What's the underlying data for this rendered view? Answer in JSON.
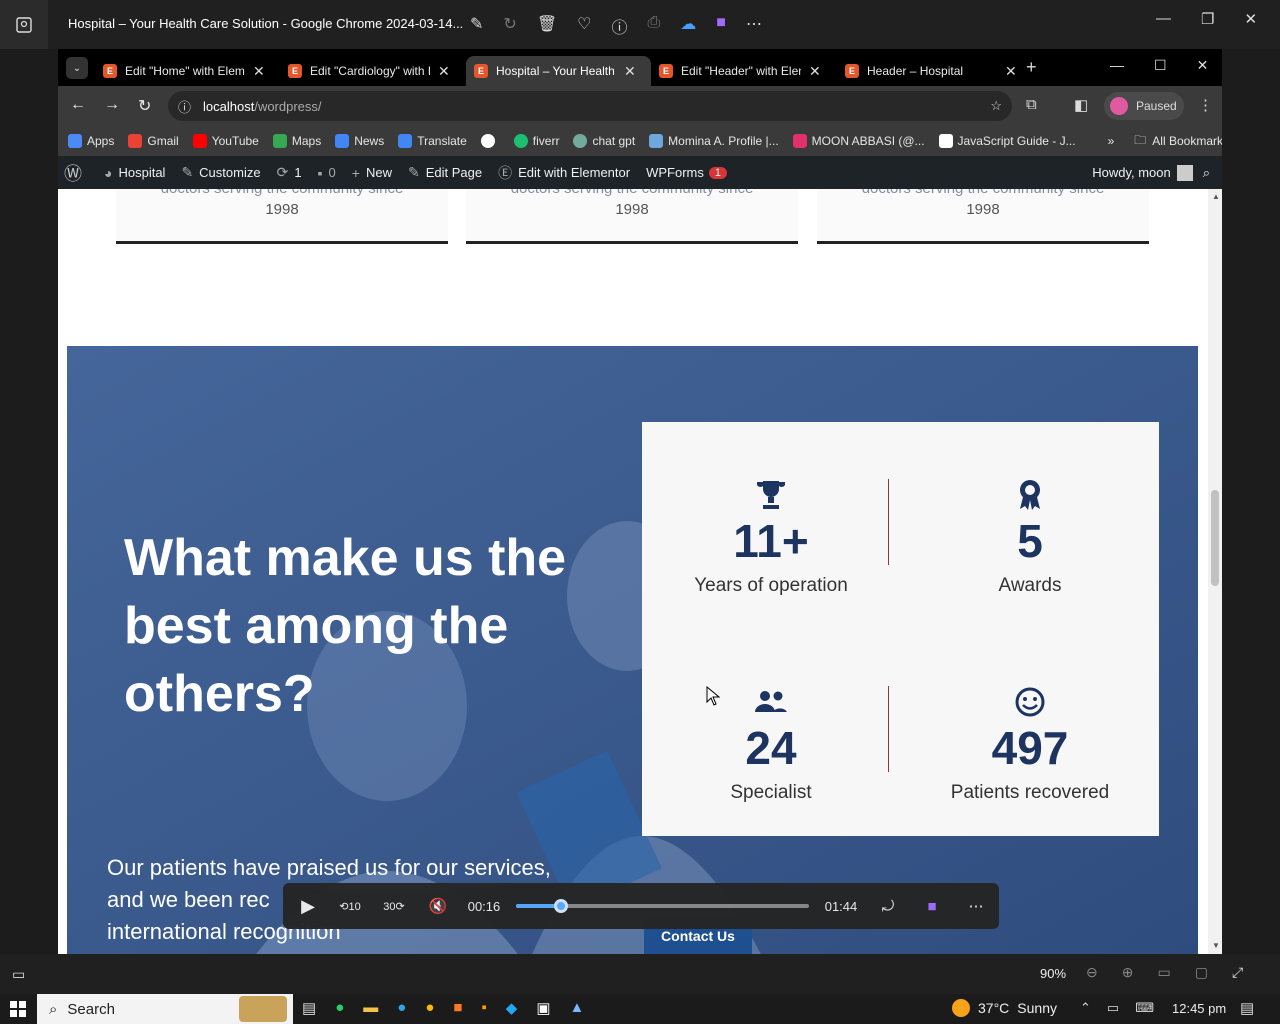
{
  "window": {
    "title": "Hospital – Your Health Care Solution - Google Chrome 2024-03-14..."
  },
  "chrome": {
    "tabs": [
      {
        "label": "Edit \"Home\" with Elementor"
      },
      {
        "label": "Edit \"Cardiology\" with Elementor"
      },
      {
        "label": "Hospital – Your Health Care Solution"
      },
      {
        "label": "Edit \"Header\" with Elementor"
      },
      {
        "label": "Header – Hospital"
      }
    ],
    "url_host": "localhost",
    "url_path": "/wordpress/",
    "profile_status": "Paused",
    "bookmarks": [
      {
        "label": "Apps",
        "color": "#4c8bf5"
      },
      {
        "label": "Gmail",
        "color": "#ea4335"
      },
      {
        "label": "YouTube",
        "color": "#ff0000"
      },
      {
        "label": "Maps",
        "color": "#34a853"
      },
      {
        "label": "News",
        "color": "#4285f4"
      },
      {
        "label": "Translate",
        "color": "#4285f4"
      },
      {
        "label": "",
        "color": "#ffffff"
      },
      {
        "label": "fiverr",
        "color": "#1dbf73"
      },
      {
        "label": "chat gpt",
        "color": "#74aa9c"
      },
      {
        "label": "Momina A. Profile |...",
        "color": "#6fa8dc"
      },
      {
        "label": "MOON ABBASI (@...",
        "color": "#e1306c"
      },
      {
        "label": "JavaScript Guide - J...",
        "color": "#ffffff"
      }
    ],
    "all_bookmarks": "All Bookmarks"
  },
  "adminbar": {
    "site": "Hospital",
    "customize": "Customize",
    "updates": "1",
    "comments": "0",
    "new": "New",
    "edit_page": "Edit Page",
    "edit_elementor": "Edit with Elementor",
    "wpforms": "WPForms",
    "wpforms_badge": "1",
    "howdy": "Howdy, moon"
  },
  "page": {
    "cards": [
      {
        "faded": "doctors serving the community since",
        "year": "1998"
      },
      {
        "faded": "doctors serving the community since",
        "year": "1998"
      },
      {
        "faded": "doctors serving the community since",
        "year": "1998"
      }
    ],
    "hero_heading_1": "What make us the",
    "hero_heading_2": "best among the",
    "hero_heading_3": "others?",
    "hero_text_1": "Our patients have praised us for our services,",
    "hero_text_2": "and we been rec",
    "hero_text_3": "international recognition",
    "contact_button": "Contact Us",
    "stats": [
      {
        "icon": "trophy-icon",
        "number": "11+",
        "label": "Years of operation"
      },
      {
        "icon": "award-ribbon-icon",
        "number": "5",
        "label": "Awards"
      },
      {
        "icon": "people-icon",
        "number": "24",
        "label": "Specialist"
      },
      {
        "icon": "smiley-icon",
        "number": "497",
        "label": "Patients recovered"
      }
    ]
  },
  "player": {
    "current_time": "00:16",
    "total_time": "01:44",
    "progress": 0.155,
    "zoom": "90%"
  },
  "taskbar": {
    "search_placeholder": "Search",
    "temperature": "37°C",
    "weather": "Sunny",
    "time": "12:45 pm"
  },
  "colors": {
    "accent": "#1d3461",
    "hero_overlay": "#3c5a8c",
    "progress": "#5aa9ff"
  }
}
